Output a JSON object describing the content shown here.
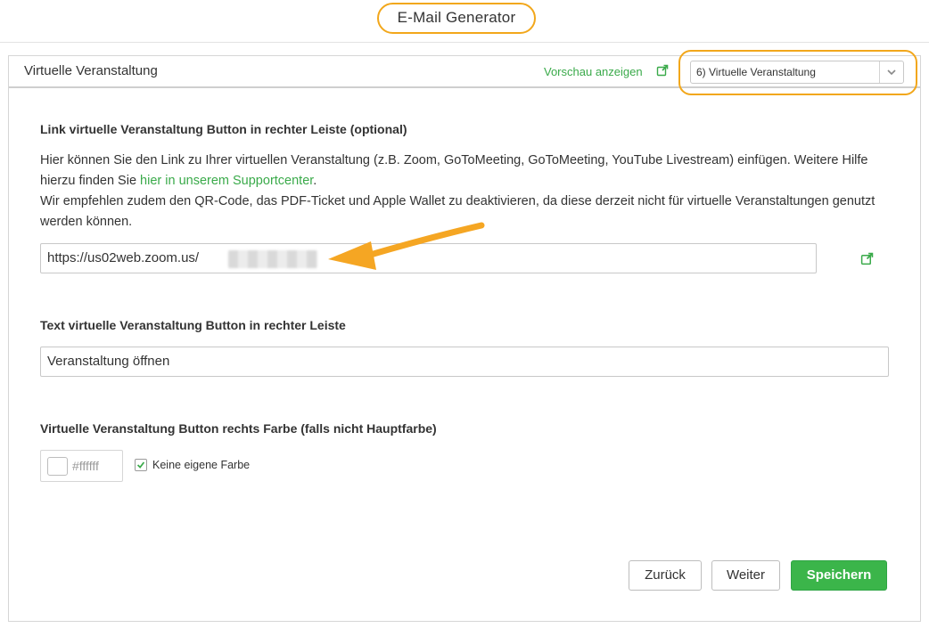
{
  "header": {
    "title": "E-Mail Generator"
  },
  "panel": {
    "title": "Virtuelle Veranstaltung",
    "preview_label": "Vorschau anzeigen",
    "step_select": {
      "value": "6) Virtuelle Veranstaltung"
    }
  },
  "link_section": {
    "label": "Link virtuelle Veranstaltung Button in rechter Leiste (optional)",
    "help_part1": "Hier können Sie den Link zu Ihrer virtuellen Veranstaltung (z.B. Zoom, GoToMeeting, GoToMeeting, YouTube Livestream) einfügen. Weitere Hilfe hierzu finden Sie ",
    "help_link": "hier in unserem Supportcenter",
    "help_part2": ".",
    "help_part3": "Wir empfehlen zudem den QR-Code, das PDF-Ticket und Apple Wallet zu deaktivieren, da diese derzeit nicht für virtuelle Veranstaltungen genutzt werden können.",
    "url_value": "https://us02web.zoom.us/"
  },
  "text_section": {
    "label": "Text virtuelle Veranstaltung Button in rechter Leiste",
    "value": "Veranstaltung öffnen"
  },
  "color_section": {
    "label": "Virtuelle Veranstaltung Button rechts Farbe (falls nicht Hauptfarbe)",
    "hex_placeholder": "#ffffff",
    "swatch_color": "#ffffff",
    "checkbox_label": "Keine eigene Farbe",
    "checkbox_checked": true
  },
  "buttons": {
    "back": "Zurück",
    "next": "Weiter",
    "save": "Speichern"
  },
  "colors": {
    "accent": "#3bb54a",
    "highlight": "#f2a71b",
    "link": "#3aaa4a"
  }
}
